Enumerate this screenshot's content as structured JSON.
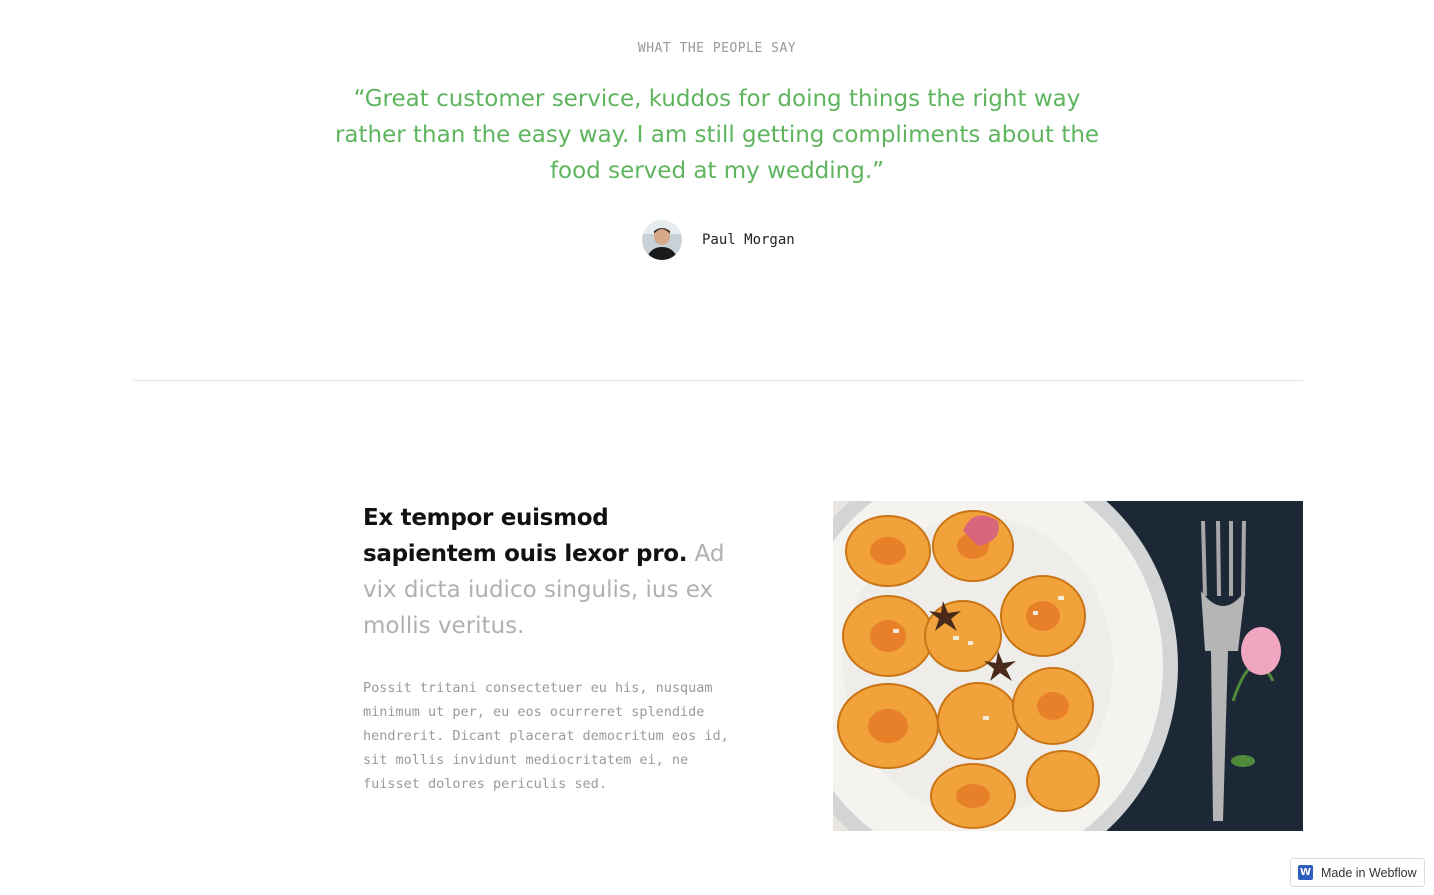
{
  "testimonial": {
    "eyebrow": "WHAT THE PEOPLE SAY",
    "quote": "“Great customer service, kuddos for doing things the right way rather than the easy way. I am still getting compliments about the food served at my wedding.”",
    "author": "Paul Morgan",
    "accent_color": "#5eb55e"
  },
  "feature": {
    "heading_strong": "Ex tempor euismod sapientem ouis lexor pro.",
    "heading_light": "Ad vix dicta iudico singulis, ius ex mollis veritus.",
    "body": "Possit tritani consectetuer eu his, nusquam minimum ut per, eu eos ocurreret splendide hendrerit. Dicant placerat democritum eos id, sit mollis invidunt mediocritatem ei, ne fuisset dolores periculis sed.",
    "image_icon": "food-plate-photo"
  },
  "badge": {
    "label": "Made in Webflow",
    "logo_letter": "W",
    "logo_color": "#2e5fbf"
  }
}
